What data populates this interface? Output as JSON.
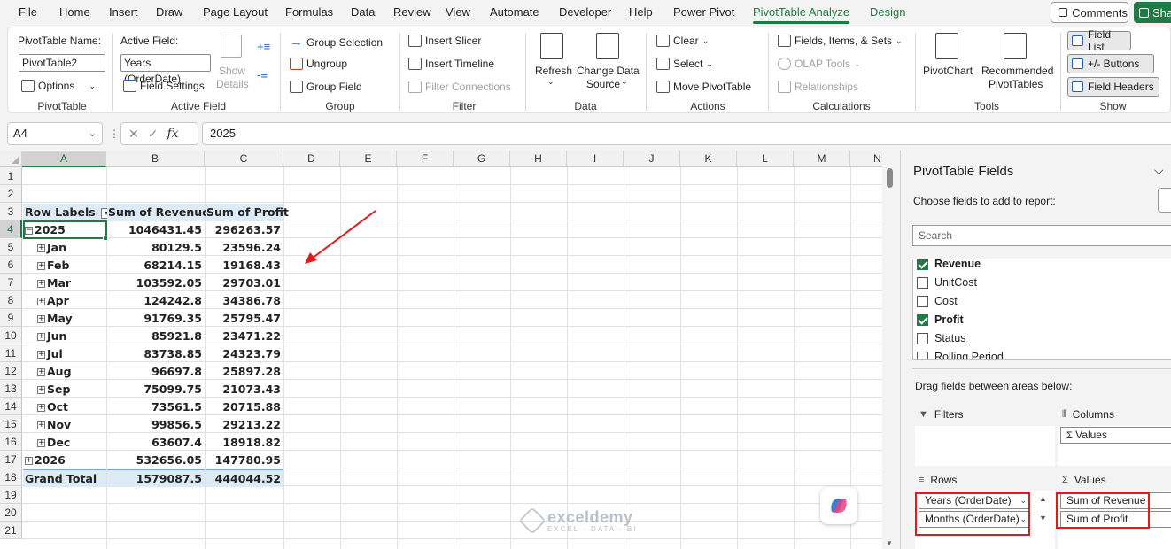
{
  "ribbon_tabs": [
    "File",
    "Home",
    "Insert",
    "Draw",
    "Page Layout",
    "Formulas",
    "Data",
    "Review",
    "View",
    "Automate",
    "Developer",
    "Help",
    "Power Pivot",
    "PivotTable Analyze",
    "Design"
  ],
  "comments_label": "Comments",
  "share_label": "Sha",
  "ribbon": {
    "pivottable": {
      "name_label": "PivotTable Name:",
      "name_value": "PivotTable2",
      "options_label": "Options",
      "group_label": "PivotTable"
    },
    "active_field": {
      "label": "Active Field:",
      "value": "Years (OrderDate)",
      "field_settings": "Field Settings",
      "show_details_1": "Show",
      "show_details_2": "Details",
      "group_label": "Active Field"
    },
    "group": {
      "group_selection": "Group Selection",
      "ungroup": "Ungroup",
      "group_field": "Group Field",
      "group_label": "Group"
    },
    "filter": {
      "insert_slicer": "Insert Slicer",
      "insert_timeline": "Insert Timeline",
      "filter_connections": "Filter Connections",
      "group_label": "Filter"
    },
    "data": {
      "refresh": "Refresh",
      "change_source_1": "Change Data",
      "change_source_2": "Source",
      "group_label": "Data"
    },
    "actions": {
      "clear": "Clear",
      "select": "Select",
      "move": "Move PivotTable",
      "group_label": "Actions"
    },
    "calculations": {
      "fields_items_sets": "Fields, Items, & Sets",
      "olap_tools": "OLAP Tools",
      "relationships": "Relationships",
      "group_label": "Calculations"
    },
    "tools": {
      "pivotchart": "PivotChart",
      "recommended_1": "Recommended",
      "recommended_2": "PivotTables",
      "group_label": "Tools"
    },
    "show": {
      "field_list": "Field List",
      "buttons": "+/- Buttons",
      "field_headers": "Field Headers",
      "group_label": "Show"
    }
  },
  "formula_bar": {
    "name_box": "A4",
    "fx": "fx",
    "value": "2025"
  },
  "columns": [
    "A",
    "B",
    "C",
    "D",
    "E",
    "F",
    "G",
    "H",
    "I",
    "J",
    "K",
    "L",
    "M",
    "N"
  ],
  "rows": [
    "1",
    "2",
    "3",
    "4",
    "5",
    "6",
    "7",
    "8",
    "9",
    "10",
    "11",
    "12",
    "13",
    "14",
    "15",
    "16",
    "17",
    "18",
    "19",
    "20",
    "21"
  ],
  "pivot": {
    "headers": [
      "Row Labels",
      "Sum of Revenue",
      "Sum of Profit"
    ],
    "year_2025": {
      "label": "2025",
      "revenue": "1046431.45",
      "profit": "296263.57"
    },
    "months": [
      {
        "label": "Jan",
        "revenue": "80129.5",
        "profit": "23596.24"
      },
      {
        "label": "Feb",
        "revenue": "68214.15",
        "profit": "19168.43"
      },
      {
        "label": "Mar",
        "revenue": "103592.05",
        "profit": "29703.01"
      },
      {
        "label": "Apr",
        "revenue": "124242.8",
        "profit": "34386.78"
      },
      {
        "label": "May",
        "revenue": "91769.35",
        "profit": "25795.47"
      },
      {
        "label": "Jun",
        "revenue": "85921.8",
        "profit": "23471.22"
      },
      {
        "label": "Jul",
        "revenue": "83738.85",
        "profit": "24323.79"
      },
      {
        "label": "Aug",
        "revenue": "96697.8",
        "profit": "25897.28"
      },
      {
        "label": "Sep",
        "revenue": "75099.75",
        "profit": "21073.43"
      },
      {
        "label": "Oct",
        "revenue": "73561.5",
        "profit": "20715.88"
      },
      {
        "label": "Nov",
        "revenue": "99856.5",
        "profit": "29213.22"
      },
      {
        "label": "Dec",
        "revenue": "63607.4",
        "profit": "18918.82"
      }
    ],
    "year_2026": {
      "label": "2026",
      "revenue": "532656.05",
      "profit": "147780.95"
    },
    "grand_total": {
      "label": "Grand Total",
      "revenue": "1579087.5",
      "profit": "444044.52"
    }
  },
  "pane": {
    "title": "PivotTable Fields",
    "subtitle": "Choose fields to add to report:",
    "search_placeholder": "Search",
    "fields": [
      {
        "name": "Revenue",
        "checked": true
      },
      {
        "name": "UnitCost",
        "checked": false
      },
      {
        "name": "Cost",
        "checked": false
      },
      {
        "name": "Profit",
        "checked": true
      },
      {
        "name": "Status",
        "checked": false
      },
      {
        "name": "Rolling Period",
        "checked": false
      }
    ],
    "drag_label": "Drag fields between areas below:",
    "filters_label": "Filters",
    "columns_label": "Columns",
    "columns_chip": "Values",
    "rows_label": "Rows",
    "values_label": "Values",
    "rows_chips": [
      "Years (OrderDate)",
      "Months (OrderDate)"
    ],
    "values_chips": [
      "Sum of Revenue",
      "Sum of Profit"
    ]
  },
  "watermark": {
    "name": "exceldemy",
    "sub": "EXCEL · DATA · BI"
  },
  "colors": {
    "accent": "#1f7a45",
    "pivot_header": "#ddebf7",
    "annotation": "#e01b1b"
  }
}
